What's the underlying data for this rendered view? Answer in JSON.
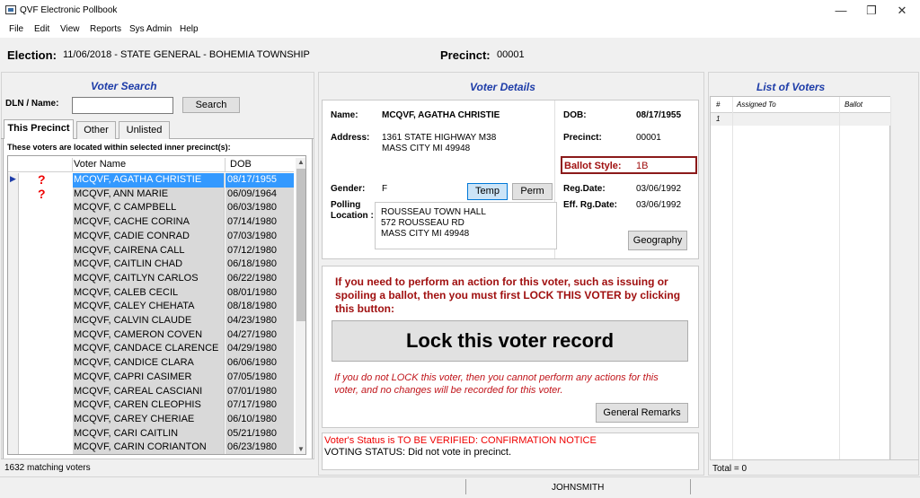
{
  "window": {
    "title": "QVF Electronic Pollbook",
    "minimize": "—",
    "restore": "❐",
    "close": "✕"
  },
  "menu": [
    "File",
    "Edit",
    "View",
    "Reports",
    "Sys Admin",
    "Help"
  ],
  "election": {
    "label": "Election:",
    "value": "11/06/2018 - STATE GENERAL - BOHEMIA TOWNSHIP",
    "precinct_label": "Precinct:",
    "precinct_value": "00001"
  },
  "voter_search": {
    "heading": "Voter Search",
    "dln_label": "DLN / Name:",
    "dln_value": "",
    "search_label": "Search",
    "tabs": [
      "This Precinct",
      "Other",
      "Unlisted"
    ],
    "note": "These voters are located within selected inner precinct(s):",
    "columns": [
      "Voter Name",
      "DOB"
    ],
    "rows": [
      {
        "name": "MCQVF, AGATHA  CHRISTIE",
        "dob": "08/17/1955",
        "flag": "?",
        "selected": true
      },
      {
        "name": "MCQVF, ANN  MARIE",
        "dob": "06/09/1964",
        "flag": "?"
      },
      {
        "name": "MCQVF, C CAMPBELL",
        "dob": "06/03/1980"
      },
      {
        "name": "MCQVF, CACHE CORINA",
        "dob": "07/14/1980"
      },
      {
        "name": "MCQVF, CADIE CONRAD",
        "dob": "07/03/1980"
      },
      {
        "name": "MCQVF, CAIRENA CALL",
        "dob": "07/12/1980"
      },
      {
        "name": "MCQVF, CAITLIN CHAD",
        "dob": "06/18/1980"
      },
      {
        "name": "MCQVF, CAITLYN CARLOS",
        "dob": "06/22/1980"
      },
      {
        "name": "MCQVF, CALEB CECIL",
        "dob": "08/01/1980"
      },
      {
        "name": "MCQVF, CALEY CHEHATA",
        "dob": "08/18/1980"
      },
      {
        "name": "MCQVF, CALVIN CLAUDE",
        "dob": "04/23/1980"
      },
      {
        "name": "MCQVF, CAMERON COVEN",
        "dob": "04/27/1980"
      },
      {
        "name": "MCQVF, CANDACE CLARENCE",
        "dob": "04/29/1980"
      },
      {
        "name": "MCQVF, CANDICE CLARA",
        "dob": "06/06/1980"
      },
      {
        "name": "MCQVF, CAPRI CASIMER",
        "dob": "07/05/1980"
      },
      {
        "name": "MCQVF, CAREAL CASCIANI",
        "dob": "07/01/1980"
      },
      {
        "name": "MCQVF, CAREN CLEOPHIS",
        "dob": "07/17/1980"
      },
      {
        "name": "MCQVF, CAREY CHERIAE",
        "dob": "06/10/1980"
      },
      {
        "name": "MCQVF, CARI CAITLIN",
        "dob": "05/21/1980"
      },
      {
        "name": "MCQVF, CARIN CORIANTON",
        "dob": "06/23/1980"
      }
    ],
    "count_text": "1632 matching voters"
  },
  "voter_details": {
    "heading": "Voter Details",
    "name_label": "Name:",
    "name_value": "MCQVF, AGATHA  CHRISTIE",
    "dob_label": "DOB:",
    "dob_value": "08/17/1955",
    "address_label": "Address:",
    "address_line1": "1361 STATE HIGHWAY M38",
    "address_line2": "MASS CITY MI 49948",
    "precinct_label": "Precinct:",
    "precinct_value": "00001",
    "ballot_style_label": "Ballot Style:",
    "ballot_style_value": "1B",
    "gender_label": "Gender:",
    "gender_value": "F",
    "temp_label": "Temp",
    "perm_label": "Perm",
    "reg_date_label": "Reg.Date:",
    "reg_date_value": "03/06/1992",
    "eff_reg_date_label": "Eff. Rg.Date:",
    "eff_reg_date_value": "03/06/1992",
    "polling_label1": "Polling",
    "polling_label2": "Location :",
    "polling_line1": "ROUSSEAU TOWN HALL",
    "polling_line2": "572 ROUSSEAU RD",
    "polling_line3": "MASS CITY MI 49948",
    "geography_label": "Geography"
  },
  "lock": {
    "instruction_line1": "If you need to perform an action for this voter, such as issuing or",
    "instruction_line2": "spoiling a ballot, then you must first LOCK THIS VOTER by clicking",
    "instruction_line3": "this button:",
    "button_label": "Lock this voter record",
    "warning_line1": "If you do not LOCK this voter, then you cannot perform any actions for this",
    "warning_line2": "voter, and no changes will be recorded for this voter.",
    "remarks_label": "General Remarks"
  },
  "status": {
    "line1": "Voter's Status is TO BE VERIFIED: CONFIRMATION NOTICE",
    "line2": "VOTING STATUS: Did not vote in precinct."
  },
  "list_of_voters": {
    "heading": "List of Voters",
    "columns": [
      "#",
      "Assigned To",
      "Ballot"
    ],
    "first_row_number": "1",
    "total_text": "Total = 0"
  },
  "statusbar": {
    "user": "JOHNSMITH"
  },
  "colors": {
    "heading_blue": "#1d3ca8",
    "warning_red": "#c0141a",
    "selection_blue": "#3399ff"
  }
}
